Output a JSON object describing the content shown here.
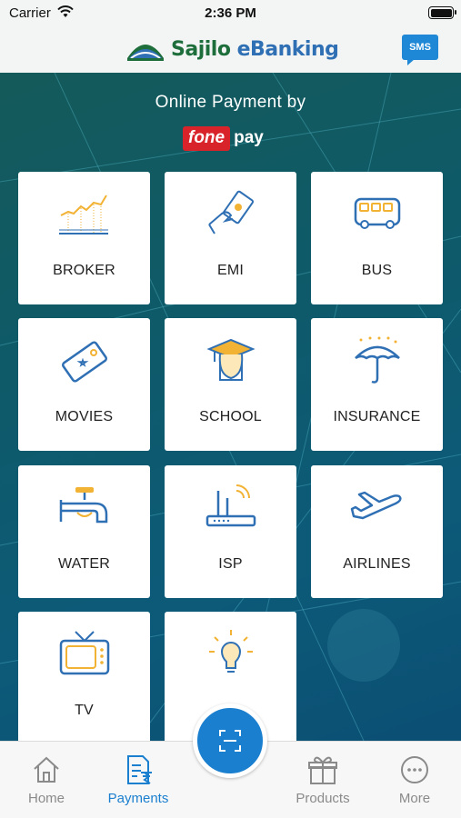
{
  "status_bar": {
    "carrier": "Carrier",
    "time": "2:36 PM",
    "battery_level": 1.0
  },
  "header": {
    "logo_text_1": "Sajilo ",
    "logo_text_e": "e",
    "logo_text_2": "Banking",
    "sms_label": "SMS"
  },
  "payment": {
    "title": "Online Payment by",
    "brand_fone": "fone",
    "brand_pay": "pay"
  },
  "tiles": [
    {
      "label": "BROKER",
      "icon": "chart-icon"
    },
    {
      "label": "EMI",
      "icon": "hand-money-icon"
    },
    {
      "label": "BUS",
      "icon": "bus-icon"
    },
    {
      "label": "MOVIES",
      "icon": "ticket-icon"
    },
    {
      "label": "SCHOOL",
      "icon": "graduate-icon"
    },
    {
      "label": "INSURANCE",
      "icon": "umbrella-icon"
    },
    {
      "label": "WATER",
      "icon": "tap-icon"
    },
    {
      "label": "ISP",
      "icon": "router-icon"
    },
    {
      "label": "AIRLINES",
      "icon": "airplane-icon"
    },
    {
      "label": "TV",
      "icon": "tv-icon"
    },
    {
      "label": "",
      "icon": "lightbulb-icon"
    }
  ],
  "tabs": [
    {
      "label": "Home",
      "icon": "home-icon",
      "active": false
    },
    {
      "label": "Payments",
      "icon": "payments-icon",
      "active": true
    },
    {
      "label": "Products",
      "icon": "gift-icon",
      "active": false
    },
    {
      "label": "More",
      "icon": "more-icon",
      "active": false
    }
  ],
  "colors": {
    "accent": "#1b7fcf",
    "icon_blue": "#2f6fb4",
    "icon_yellow": "#f2b233",
    "fonepay_red": "#d8232a"
  }
}
